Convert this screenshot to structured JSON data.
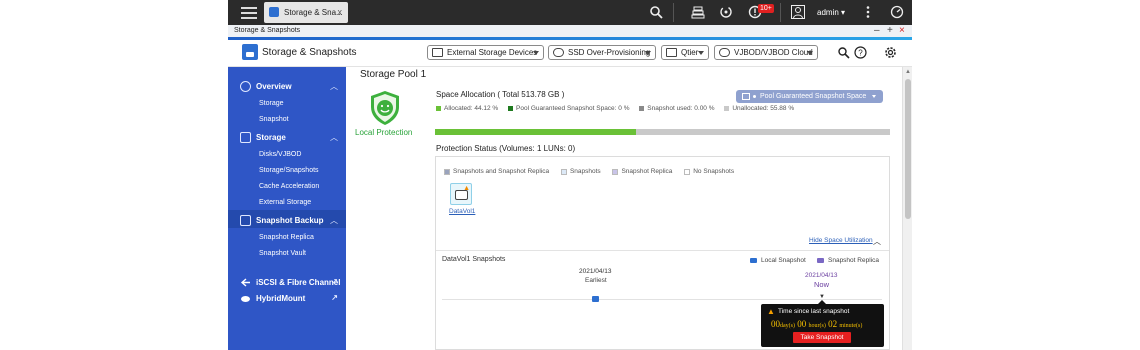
{
  "topbar": {
    "tab_label": "Storage & Sna...",
    "tab_close": "x",
    "notification_count": "10+",
    "user_name": "admin",
    "user_caret": "▾"
  },
  "window": {
    "title": "Storage & Snapshots",
    "min": "–",
    "max": "+",
    "close": "×"
  },
  "app": {
    "title": "Storage & Snapshots",
    "dropdowns": [
      "External Storage Devices",
      "SSD Over-Provisioning",
      "Qtier",
      "VJBOD/VJBOD Cloud"
    ]
  },
  "sidebar": {
    "sections": [
      {
        "label": "Overview",
        "items": [
          "Storage",
          "Snapshot"
        ]
      },
      {
        "label": "Storage",
        "items": [
          "Disks/VJBOD",
          "Storage/Snapshots",
          "Cache Acceleration",
          "External Storage"
        ]
      },
      {
        "label": "Snapshot Backup",
        "items": [
          "Snapshot Replica",
          "Snapshot Vault"
        ]
      }
    ],
    "links": [
      "iSCSI & Fibre Channel",
      "HybridMount"
    ]
  },
  "main": {
    "pool_title": "Storage Pool 1",
    "protection_label": "Local Protection",
    "space_allocation_title": "Space Allocation ( Total 513.78 GB )",
    "legend": [
      {
        "label": "Allocated: 44.12 %",
        "color": "#6ac137"
      },
      {
        "label": "Pool Guaranteed Snapshot Space: 0 %",
        "color": "#1e7a1e"
      },
      {
        "label": "Snapshot used: 0.00 %",
        "color": "#8a8a8a"
      },
      {
        "label": "Unallocated: 55.88 %",
        "color": "#c9c9c9"
      }
    ],
    "allocated_fraction": 0.4412,
    "pool_guaranteed_button": "Pool Guaranteed Snapshot Space",
    "protection_status_title": "Protection Status (Volumes: 1 LUNs: 0)",
    "protection_legend": [
      {
        "label": "Snapshots and Snapshot Replica",
        "color": "#9aa3bd"
      },
      {
        "label": "Snapshots",
        "color": "#dce9f7"
      },
      {
        "label": "Snapshot Replica",
        "color": "#c9c4e8"
      },
      {
        "label": "No Snapshots",
        "color": "#ffffff"
      }
    ],
    "volume_label": "DataVol1",
    "hide_space_utilization": "Hide Space Utilization",
    "snapshots_title": "DataVol1 Snapshots",
    "local_snapshot": "Local Snapshot",
    "snapshot_replica": "Snapshot Replica",
    "earliest_date": "2021/04/13",
    "earliest_label": "Earliest",
    "now_date": "2021/04/13",
    "now_label": "Now"
  },
  "tooltip": {
    "title": "Time since last snapshot",
    "days": "00",
    "days_unit": "day(s)",
    "hours": "00",
    "hours_unit": "hour(s)",
    "minutes": "02",
    "minutes_unit": "minute(s)",
    "button": "Take Snapshot"
  },
  "colors": {
    "sidebar": "#2f56c6",
    "accent": "#2d6fd0",
    "green": "#6ac137",
    "danger": "#e62020"
  }
}
